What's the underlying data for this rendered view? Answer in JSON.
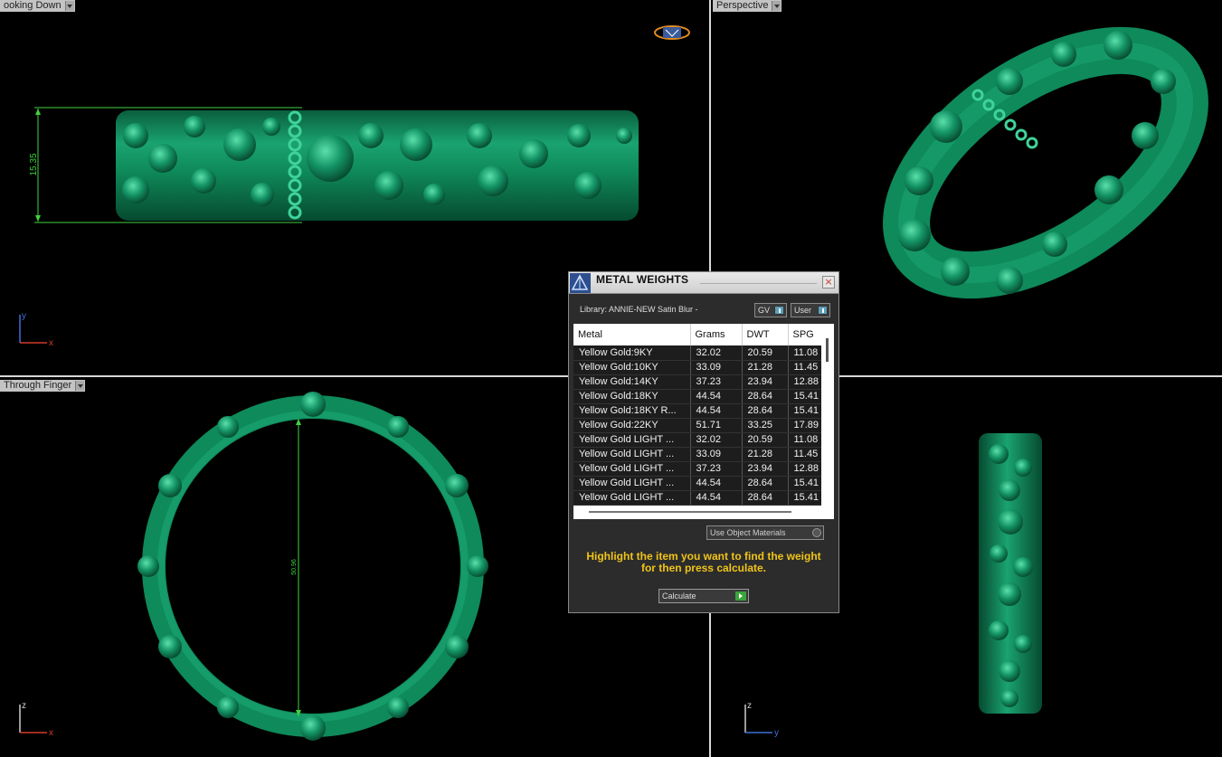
{
  "viewports": {
    "top_left": {
      "label": "ooking Down",
      "dimension": "15.35",
      "axis_up": "y",
      "axis_right": "x"
    },
    "top_right": {
      "label": "Perspective"
    },
    "bottom_left": {
      "label": "Through Finger",
      "dimension": "50.96",
      "axis_up": "z",
      "axis_right": "x"
    },
    "bottom_right": {
      "axis_up": "z",
      "axis_right": "y"
    }
  },
  "dialog": {
    "title": "METAL WEIGHTS",
    "close": "×",
    "library": "Library: ANNIE-NEW Satin Blur -",
    "toggle_gv": "GV",
    "toggle_user": "User",
    "columns": [
      "Metal",
      "Grams",
      "DWT",
      "SPG"
    ],
    "rows": [
      [
        "Yellow Gold:9KY",
        "32.02",
        "20.59",
        "11.08"
      ],
      [
        "Yellow Gold:10KY",
        "33.09",
        "21.28",
        "11.45"
      ],
      [
        "Yellow Gold:14KY",
        "37.23",
        "23.94",
        "12.88"
      ],
      [
        "Yellow Gold:18KY",
        "44.54",
        "28.64",
        "15.41"
      ],
      [
        "Yellow Gold:18KY R...",
        "44.54",
        "28.64",
        "15.41"
      ],
      [
        "Yellow Gold:22KY",
        "51.71",
        "33.25",
        "17.89"
      ],
      [
        "Yellow Gold LIGHT ...",
        "32.02",
        "20.59",
        "11.08"
      ],
      [
        "Yellow Gold LIGHT ...",
        "33.09",
        "21.28",
        "11.45"
      ],
      [
        "Yellow Gold LIGHT ...",
        "37.23",
        "23.94",
        "12.88"
      ],
      [
        "Yellow Gold LIGHT ...",
        "44.54",
        "28.64",
        "15.41"
      ],
      [
        "Yellow Gold LIGHT ...",
        "44.54",
        "28.64",
        "15.41"
      ]
    ],
    "use_object_materials": "Use Object Materials",
    "hint_line1": "Highlight the item you want to find the weight",
    "hint_line2": "for then press calculate.",
    "calculate": "Calculate"
  },
  "colors": {
    "jewel": "#0f8a5a",
    "jewel_highlight": "#3fd39a",
    "dimension": "#3fd23f",
    "hint": "#f0c419",
    "axis_x": "#d23a2a",
    "axis_y": "#3f6fd8",
    "axis_z": "#cfcfcf"
  }
}
